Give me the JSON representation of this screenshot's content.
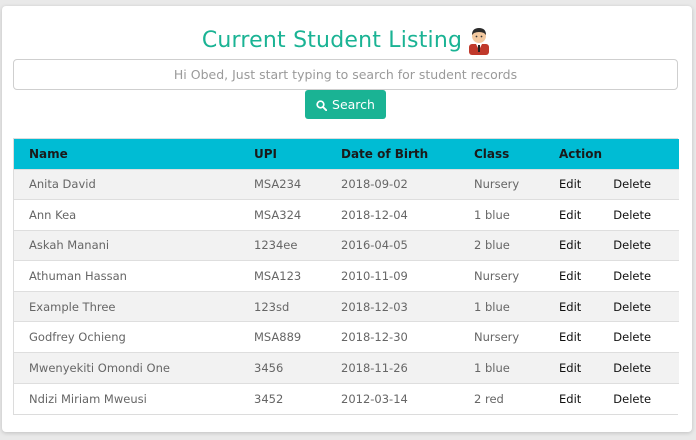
{
  "header": {
    "title": "Current Student Listing",
    "title_color": "#1ab394",
    "icon": "student-avatar-icon"
  },
  "search": {
    "placeholder": "Hi Obed, Just start typing to search for student records",
    "value": "",
    "button_label": "Search",
    "button_icon": "search-icon",
    "button_color": "#1ab394"
  },
  "table": {
    "header_color": "#00bcd4",
    "columns": [
      "Name",
      "UPI",
      "Date of Birth",
      "Class",
      "Action"
    ],
    "action_labels": {
      "edit": "Edit",
      "delete": "Delete"
    },
    "rows": [
      {
        "name": "Anita David",
        "upi": "MSA234",
        "dob": "2018-09-02",
        "class": "Nursery"
      },
      {
        "name": "Ann Kea",
        "upi": "MSA324",
        "dob": "2018-12-04",
        "class": "1 blue"
      },
      {
        "name": "Askah Manani",
        "upi": "1234ee",
        "dob": "2016-04-05",
        "class": "2 blue"
      },
      {
        "name": "Athuman Hassan",
        "upi": "MSA123",
        "dob": "2010-11-09",
        "class": "Nursery"
      },
      {
        "name": "Example Three",
        "upi": "123sd",
        "dob": "2018-12-03",
        "class": "1 blue"
      },
      {
        "name": "Godfrey Ochieng",
        "upi": "MSA889",
        "dob": "2018-12-30",
        "class": "Nursery"
      },
      {
        "name": "Mwenyekiti Omondi One",
        "upi": "3456",
        "dob": "2018-11-26",
        "class": "1 blue"
      },
      {
        "name": "Ndizi Miriam Mweusi",
        "upi": "3452",
        "dob": "2012-03-14",
        "class": "2 red"
      }
    ]
  }
}
